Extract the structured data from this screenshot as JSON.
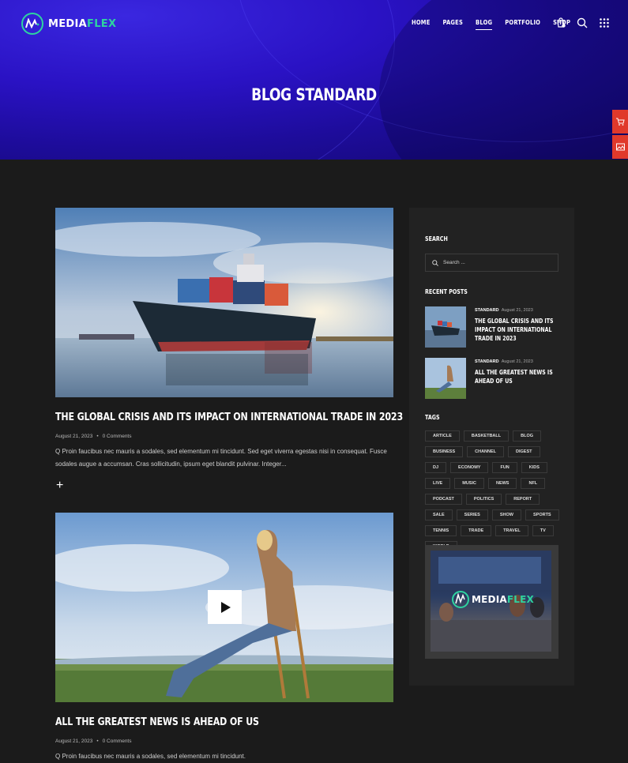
{
  "brand": {
    "name_part1": "MEDIA",
    "name_part2": "FLEX",
    "accent": "#2ed3a0"
  },
  "nav": {
    "items": [
      "HOME",
      "PAGES",
      "BLOG",
      "PORTFOLIO",
      "SHOP"
    ],
    "active": "BLOG"
  },
  "header_icons": [
    "cart-icon",
    "search-icon",
    "grid-menu-icon"
  ],
  "side_tabs": [
    "cart-icon",
    "image-icon",
    "folder-icon"
  ],
  "hero": {
    "title": "BLOG STANDARD"
  },
  "posts": [
    {
      "title": "THE GLOBAL CRISIS AND ITS IMPACT ON INTERNATIONAL TRADE IN 2023",
      "date": "August 21, 2023",
      "comments": "0 Comments",
      "excerpt": "Q Proin faucibus nec mauris a sodales, sed elementum mi tincidunt. Sed eget viverra egestas nisi in consequat. Fusce sodales augue a accumsan. Cras sollicitudin, ipsum eget blandit pulvinar. Integer...",
      "more": "+"
    },
    {
      "title": "ALL THE GREATEST NEWS IS AHEAD OF US",
      "date": "August 21, 2023",
      "comments": "0 Comments",
      "excerpt": "Q Proin faucibus nec mauris a sodales, sed elementum mi tincidunt."
    }
  ],
  "sidebar": {
    "search_heading": "SEARCH",
    "search_placeholder": "Search ...",
    "recent_heading": "RECENT POSTS",
    "recent": [
      {
        "category": "STANDARD",
        "date": "August 21, 2023",
        "title": "THE GLOBAL CRISIS AND ITS IMPACT ON INTERNATIONAL TRADE IN 2023"
      },
      {
        "category": "STANDARD",
        "date": "August 21, 2023",
        "title": "ALL THE GREATEST NEWS IS AHEAD OF US"
      }
    ],
    "tags_heading": "TAGS",
    "tags": [
      "ARTICLE",
      "BASKETBALL",
      "BLOG",
      "BUSINESS",
      "CHANNEL",
      "DIGEST",
      "DJ",
      "ECONOMY",
      "FUN",
      "KIDS",
      "LIVE",
      "MUSIC",
      "NEWS",
      "NFL",
      "PODCAST",
      "POLITICS",
      "REPORT",
      "SALE",
      "SERIES",
      "SHOW",
      "SPORTS",
      "TENNIS",
      "TRADE",
      "TRAVEL",
      "TV",
      "WORLD"
    ],
    "ad_logo_part1": "MEDIA",
    "ad_logo_part2": "FLEX"
  }
}
